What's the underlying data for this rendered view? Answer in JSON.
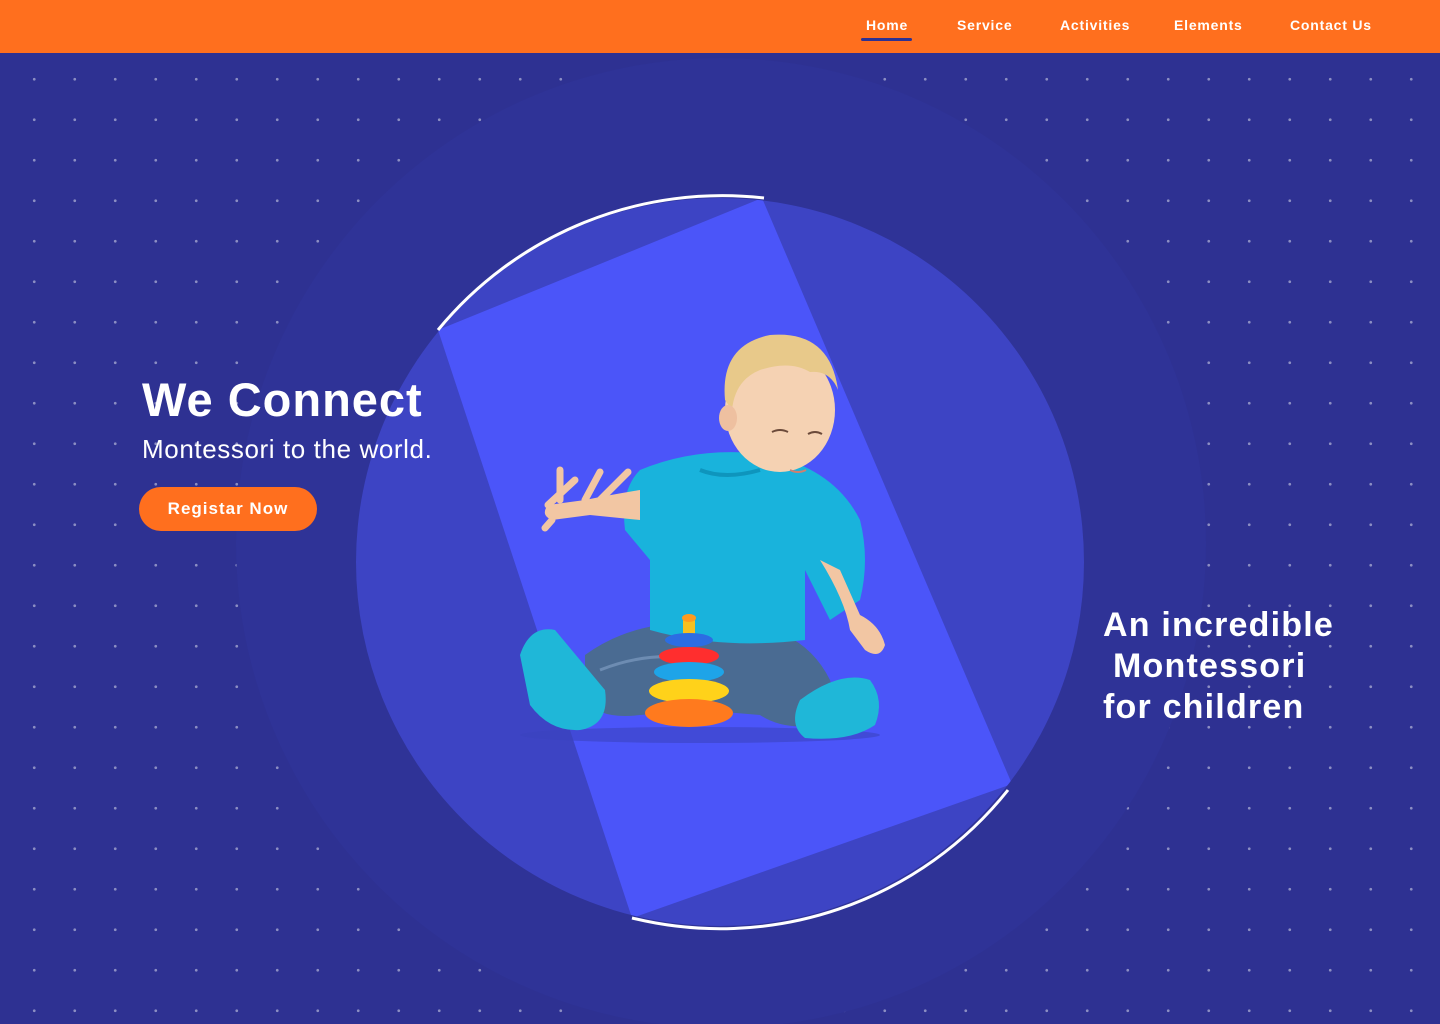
{
  "nav": {
    "items": [
      {
        "label": "Home",
        "active": true
      },
      {
        "label": "Service",
        "active": false
      },
      {
        "label": "Activities",
        "active": false
      },
      {
        "label": "Elements",
        "active": false
      },
      {
        "label": "Contact Us",
        "active": false
      }
    ]
  },
  "hero": {
    "title": "We Connect",
    "subtitle": "Montessori to the world.",
    "cta_label": "Registar Now",
    "tagline_lines": [
      "An incredible",
      "Montessori",
      "for children"
    ],
    "image": "child-playing-with-stacking-rings"
  },
  "colors": {
    "nav_bg": "#ff6f1e",
    "page_bg": "#2e3192",
    "circle_inner": "#3d44c4",
    "band": "#4b55f9",
    "accent": "#ff6f1e",
    "text": "#ffffff"
  }
}
